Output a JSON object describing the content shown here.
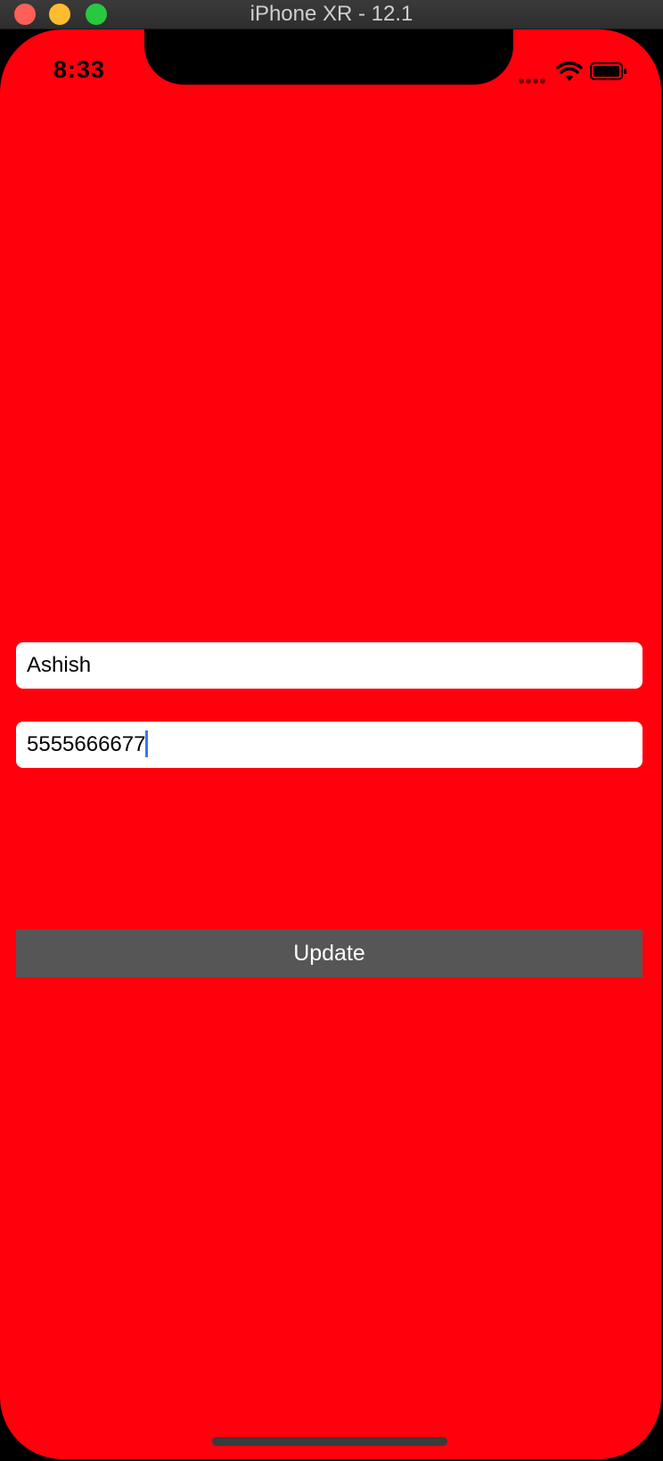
{
  "window": {
    "title": "iPhone XR - 12.1"
  },
  "status_bar": {
    "time": "8:33",
    "icons": [
      "signal-icon",
      "wifi-icon",
      "battery-icon"
    ]
  },
  "form": {
    "name_value": "Ashish",
    "phone_value": "5555666677",
    "update_label": "Update"
  },
  "colors": {
    "background": "#ff000c",
    "button": "#565656",
    "caret": "#3478f6"
  }
}
